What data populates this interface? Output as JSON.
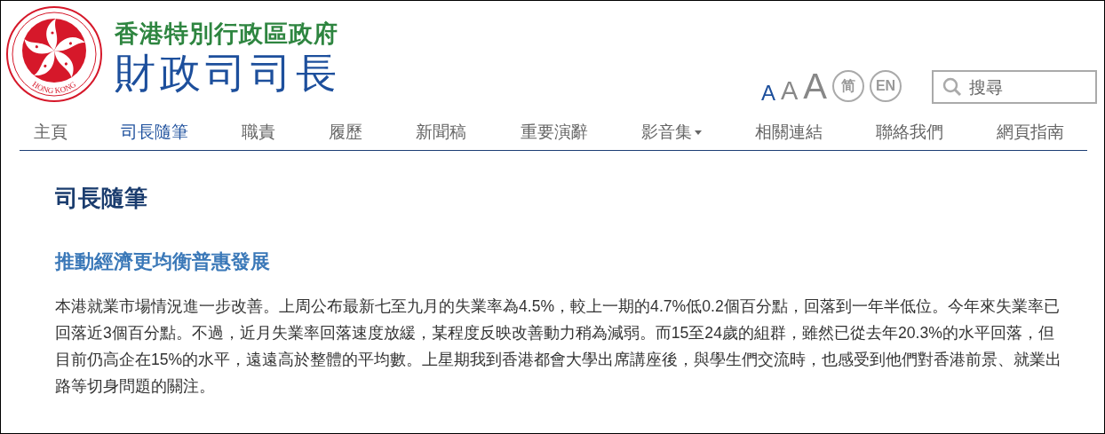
{
  "header": {
    "emblem_text": "HONG KONG",
    "org": "香港特別行政區政府",
    "office": "財政司司長"
  },
  "tools": {
    "font_sizes": [
      {
        "label": "A",
        "kind": "small",
        "selected": true
      },
      {
        "label": "A",
        "kind": "medium",
        "selected": false
      },
      {
        "label": "A",
        "kind": "large",
        "selected": false
      }
    ],
    "languages": [
      "简",
      "EN"
    ],
    "search": {
      "placeholder": "搜尋"
    }
  },
  "nav": [
    {
      "label": "主頁",
      "selected": false,
      "dropdown": false
    },
    {
      "label": "司長隨筆",
      "selected": true,
      "dropdown": false
    },
    {
      "label": "職責",
      "selected": false,
      "dropdown": false
    },
    {
      "label": "履歷",
      "selected": false,
      "dropdown": false
    },
    {
      "label": "新聞稿",
      "selected": false,
      "dropdown": false
    },
    {
      "label": "重要演辭",
      "selected": false,
      "dropdown": false
    },
    {
      "label": "影音集",
      "selected": false,
      "dropdown": true
    },
    {
      "label": "相關連結",
      "selected": false,
      "dropdown": false
    },
    {
      "label": "聯絡我們",
      "selected": false,
      "dropdown": false
    },
    {
      "label": "網頁指南",
      "selected": false,
      "dropdown": false
    }
  ],
  "content": {
    "section_title": "司長隨筆",
    "article_title": "推動經濟更均衡普惠發展",
    "paragraph": "本港就業市場情況進一步改善。上周公布最新七至九月的失業率為4.5%，較上一期的4.7%低0.2個百分點，回落到一年半低位。今年來失業率已回落近3個百分點。不過，近月失業率回落速度放緩，某程度反映改善動力稍為減弱。而15至24歲的組群，雖然已從去年20.3%的水平回落，但目前仍高企在15%的水平，遠遠高於整體的平均數。上星期我到香港都會大學出席講座後，與學生們交流時，也感受到他們對香港前景、就業出路等切身問題的關注。"
  }
}
